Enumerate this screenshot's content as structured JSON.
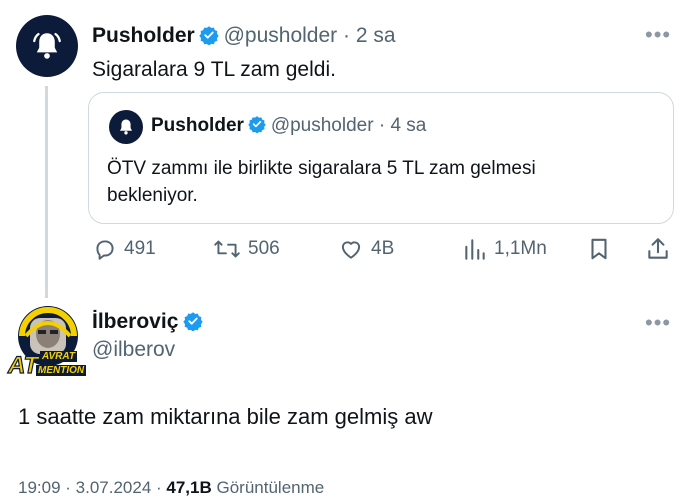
{
  "tweet": {
    "author_name": "Pusholder",
    "author_handle": "@pusholder",
    "time": "2 sa",
    "text": "Sigaralara 9 TL zam geldi.",
    "quote": {
      "author_name": "Pusholder",
      "author_handle": "@pusholder",
      "time": "4 sa",
      "text_line1": "ÖTV zammı ile birlikte sigaralara 5 TL zam gelmesi",
      "text_line2": "bekleniyor."
    },
    "actions": {
      "replies": "491",
      "retweets": "506",
      "likes": "4B",
      "views": "1,1Mn"
    }
  },
  "reply": {
    "author_name": "İlberoviç",
    "author_handle": "@ilberov",
    "text": "1 saatte zam miktarına bile zam gelmiş aw",
    "avatar_badge_top": "AVRAT",
    "avatar_badge_left": "AT",
    "avatar_badge_bottom": "MENTION",
    "timestamp": "19:09 · 3.07.2024 · ",
    "views_count": "47,1B",
    "views_label": " Görüntülenme"
  },
  "colors": {
    "verified_blue": "#1d9bf0",
    "pusholder_navy": "#0d1b3a",
    "secondary_text": "#536471",
    "fb_yellow": "#f5d000"
  }
}
